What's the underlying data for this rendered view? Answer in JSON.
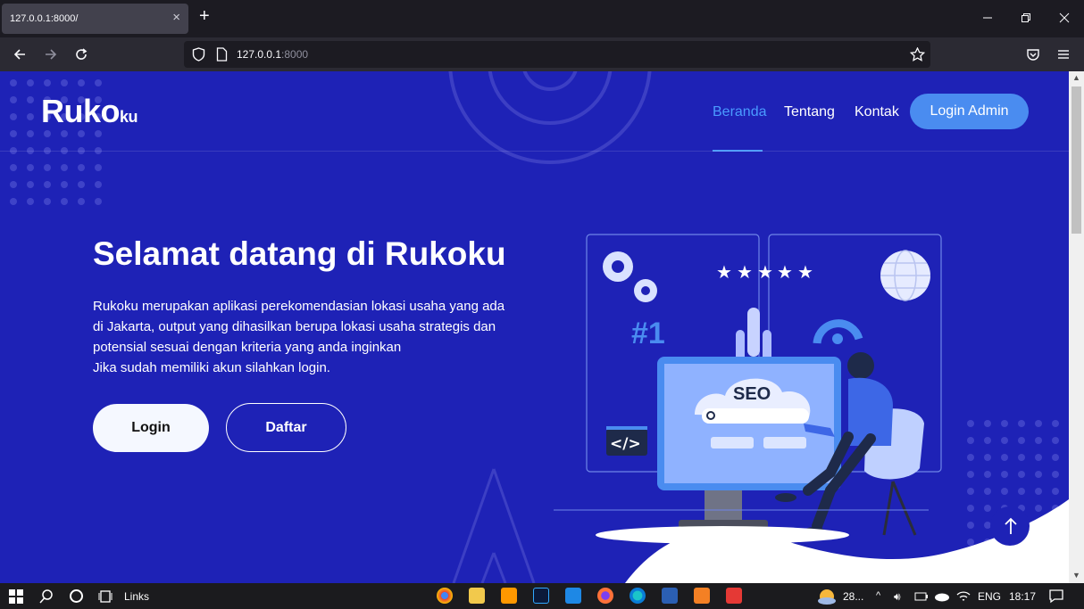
{
  "browser": {
    "tab_title": "127.0.0.1:8000/",
    "tab_close": "×",
    "new_tab": "+",
    "url_host": "127.0.0.1",
    "url_port": ":8000"
  },
  "site": {
    "logo_main": "Ruko",
    "logo_small": "ku",
    "nav": [
      "Beranda",
      "Tentang",
      "Kontak"
    ],
    "login_admin": "Login Admin",
    "hero_title": "Selamat datang di Rukoku",
    "hero_lines": [
      "Rukoku merupakan aplikasi perekomendasian lokasi usaha yang ada",
      "di Jakarta, output yang dihasilkan berupa lokasi usaha strategis dan",
      "potensial sesuai dengan kriteria yang anda inginkan",
      "Jika sudah memiliki akun silahkan login."
    ],
    "btn_login": "Login",
    "btn_daftar": "Daftar",
    "illustration": {
      "seo_label": "SEO",
      "rank_label": "#1",
      "code_label": "</>"
    }
  },
  "taskbar": {
    "links_label": "Links",
    "weather": "28...",
    "language": "ENG",
    "time": "18:17"
  },
  "colors": {
    "page_bg": "#1e22b6",
    "accent": "#4a8cf0",
    "active_nav": "#4a9bff"
  }
}
